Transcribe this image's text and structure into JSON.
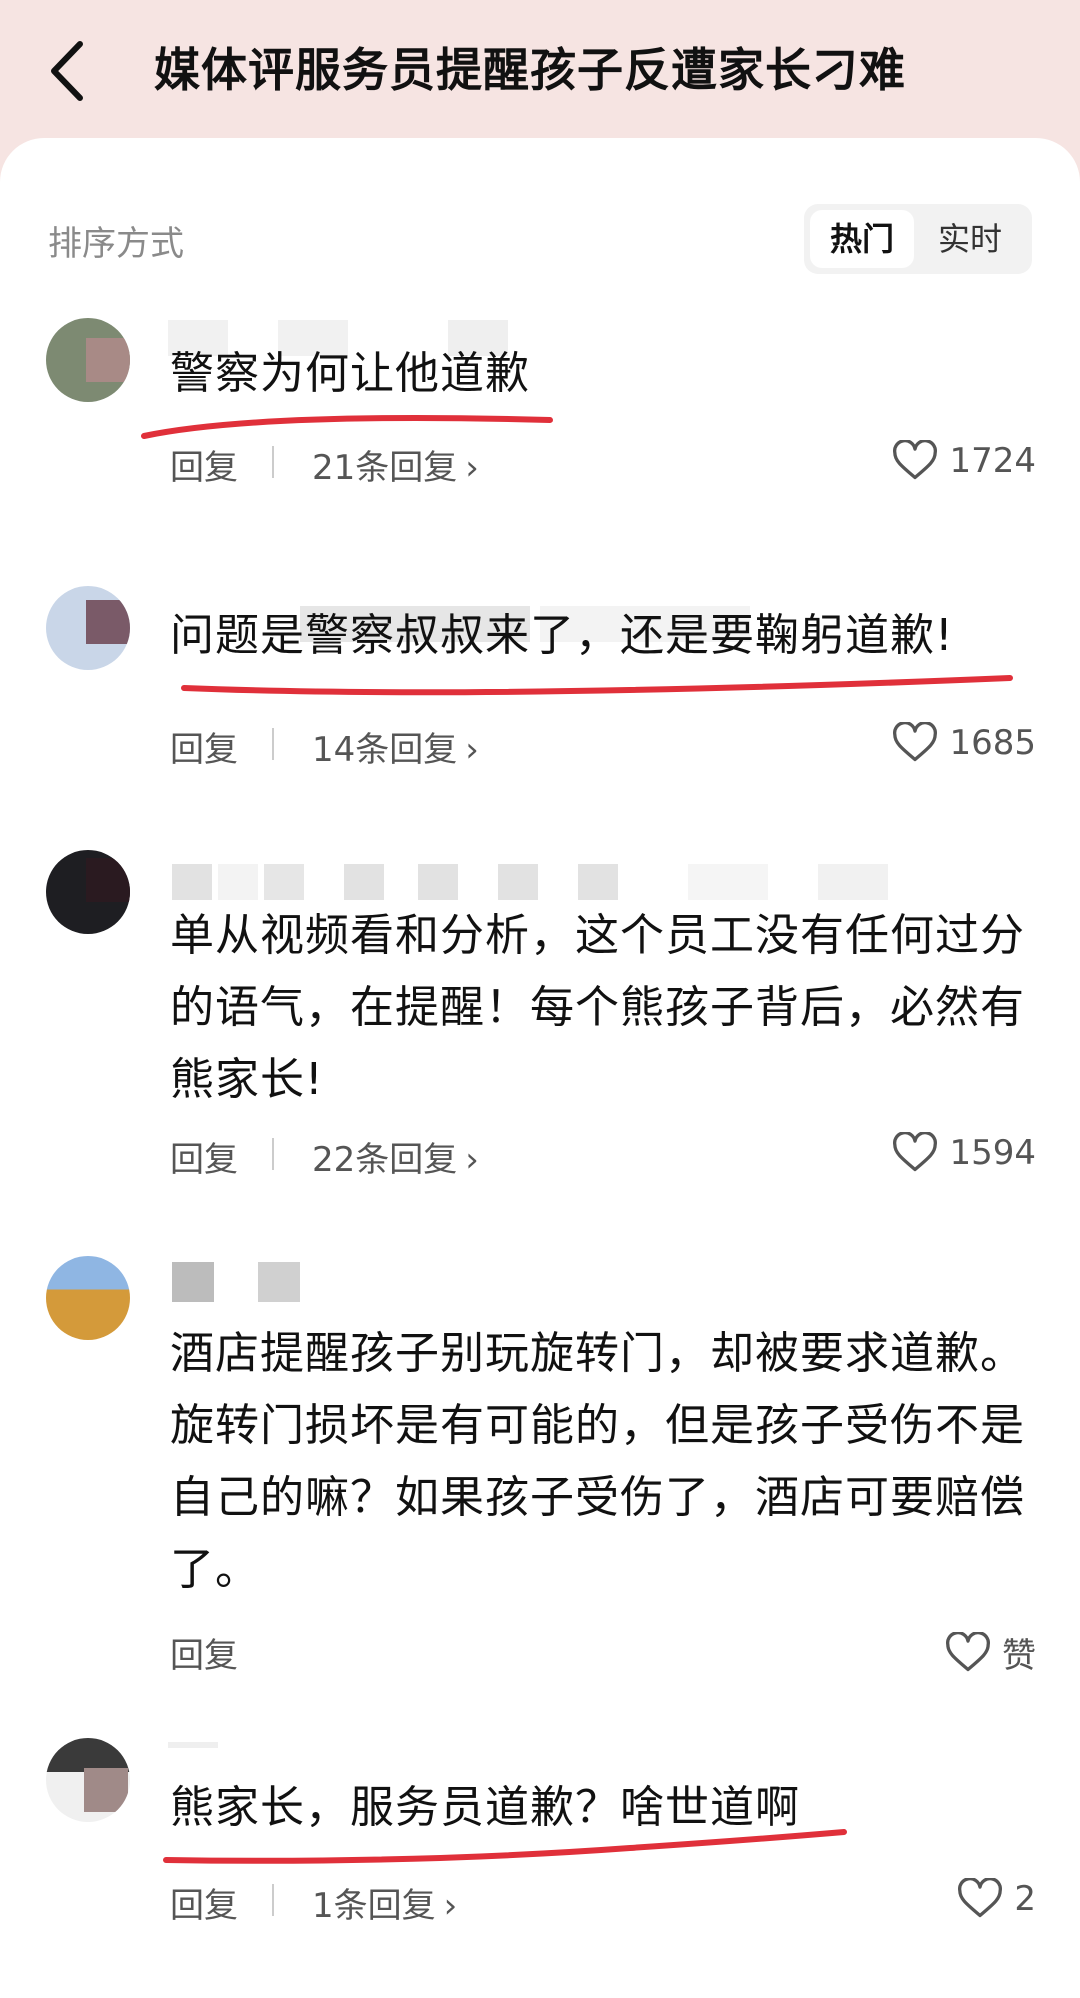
{
  "header": {
    "title": "媒体评服务员提醒孩子反遭家长刁难"
  },
  "sort": {
    "label": "排序方式",
    "options": [
      "热门",
      "实时"
    ]
  },
  "comments": [
    {
      "text": "警察为何让他道歉",
      "reply_label": "回复",
      "replies": "21条回复",
      "likes": "1724"
    },
    {
      "text": "问题是警察叔叔来了，还是要鞠躬道歉!",
      "reply_label": "回复",
      "replies": "14条回复",
      "likes": "1685"
    },
    {
      "text": "单从视频看和分析，这个员工没有任何过分的语气，在提醒！每个熊孩子背后，必然有熊家长!",
      "reply_label": "回复",
      "replies": "22条回复",
      "likes": "1594"
    },
    {
      "text": "酒店提醒孩子别玩旋转门，却被要求道歉。旋转门损坏是有可能的，但是孩子受伤不是自己的嘛？如果孩子受伤了，酒店可要赔偿了。",
      "reply_label": "回复",
      "likes": "赞"
    },
    {
      "text": "熊家长，服务员道歉？啥世道啊",
      "reply_label": "回复",
      "replies": "1条回复",
      "likes": "2"
    }
  ],
  "colors": {
    "underline": "#e0303a",
    "header_bg": "#f6e4e2"
  }
}
